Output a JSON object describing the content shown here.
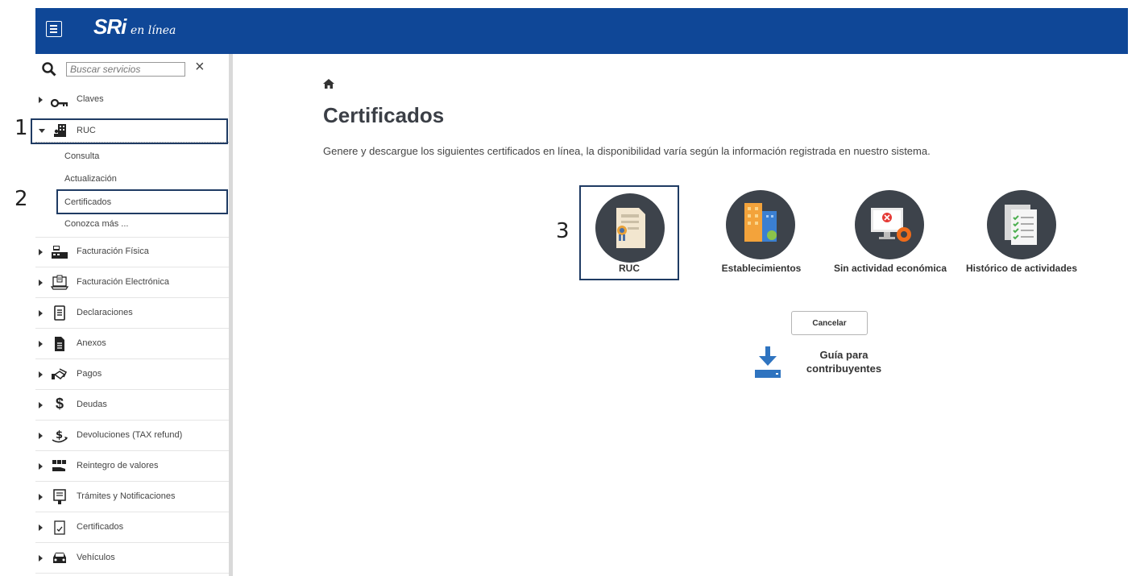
{
  "header": {
    "logo": "SRi",
    "logo_sub": "en línea"
  },
  "sidebar": {
    "search_placeholder": "Buscar servicios",
    "search_clear": "×",
    "items": [
      {
        "label": "Claves",
        "icon": "key-icon"
      },
      {
        "label": "RUC",
        "icon": "building-person-icon",
        "expanded": true,
        "subitems": [
          "Consulta",
          "Actualización",
          "Certificados",
          "Conozca más ..."
        ]
      },
      {
        "label": "Facturación Física",
        "icon": "cash-register-icon"
      },
      {
        "label": "Facturación Electrónica",
        "icon": "laptop-receipt-icon"
      },
      {
        "label": "Declaraciones",
        "icon": "document-lines-icon"
      },
      {
        "label": "Anexos",
        "icon": "file-icon"
      },
      {
        "label": "Pagos",
        "icon": "handshake-icon"
      },
      {
        "label": "Deudas",
        "icon": "dollar-icon"
      },
      {
        "label": "Devoluciones (TAX refund)",
        "icon": "refund-icon"
      },
      {
        "label": "Reintegro de valores",
        "icon": "money-hand-icon"
      },
      {
        "label": "Trámites y Notificaciones",
        "icon": "forms-icon"
      },
      {
        "label": "Certificados",
        "icon": "certificate-icon"
      },
      {
        "label": "Vehículos",
        "icon": "car-icon"
      }
    ]
  },
  "annotations": {
    "one": "1",
    "two": "2",
    "three": "3"
  },
  "main": {
    "title": "Certificados",
    "description": "Genere y descargue los siguientes certificados en línea, la disponibilidad varía según la información registrada en nuestro sistema.",
    "certificates": [
      {
        "label": "RUC"
      },
      {
        "label": "Establecimientos"
      },
      {
        "label": "Sin actividad económica"
      },
      {
        "label": "Histórico de actividades"
      }
    ],
    "cancel_label": "Cancelar",
    "guide_line1": "Guía para",
    "guide_line2": "contribuyentes"
  },
  "colors": {
    "header_bg": "#0f4797",
    "circle_bg": "#3d434b",
    "highlight_border": "#1f3b63"
  }
}
